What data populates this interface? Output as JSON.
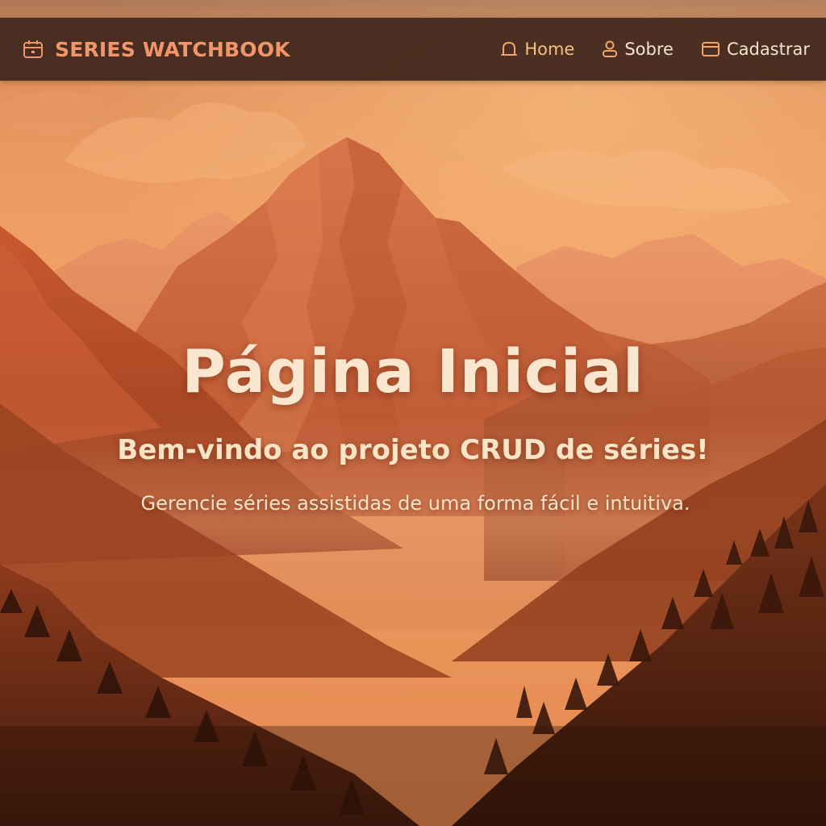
{
  "navbar": {
    "brand": {
      "icon": "calendar-icon",
      "label": "SERIES WATCHBOOK"
    },
    "links": [
      {
        "icon": "bell-icon",
        "label": "Home",
        "active": true
      },
      {
        "icon": "user-icon",
        "label": "Sobre",
        "active": false
      },
      {
        "icon": "window-icon",
        "label": "Cadastrar",
        "active": false
      }
    ]
  },
  "hero": {
    "title": "Página Inicial",
    "subtitle": "Bem-vindo ao projeto CRUD de séries!",
    "description": "Gerencie séries assistidas de uma forma fácil e intuitiva."
  },
  "colors": {
    "brand": "#f2956a",
    "active_link": "#f2c17a",
    "nav_text": "#f6e2cf",
    "navbar_bg": "#3d261c",
    "hero_text": "#fbe7cf"
  }
}
